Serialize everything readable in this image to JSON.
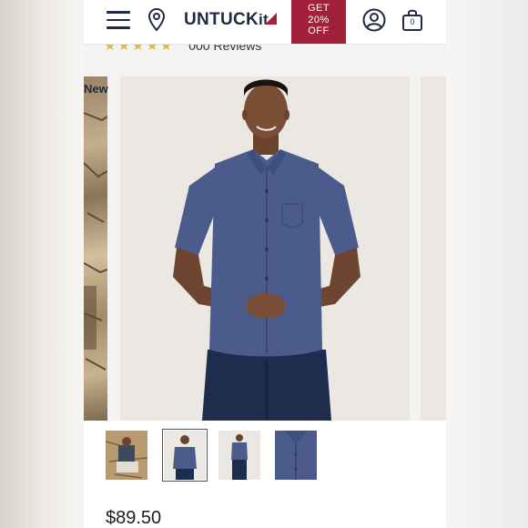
{
  "header": {
    "menu_icon": "hamburger-menu-icon",
    "location_icon": "map-pin-icon",
    "logo_text": "UNTUCK",
    "logo_suffix": "it",
    "promo_line1": "GET",
    "promo_line2": "20%",
    "promo_line3": "OFF",
    "account_icon": "user-account-icon",
    "cart_icon": "shopping-bag-icon",
    "cart_count": "0"
  },
  "reviews": {
    "stars": "★★★★★",
    "count_text": "000 Reviews"
  },
  "gallery": {
    "badge": "New",
    "active_index": 1
  },
  "thumbnails": [
    {
      "label": "lifestyle-seated"
    },
    {
      "label": "front-view"
    },
    {
      "label": "full-front-view"
    },
    {
      "label": "fabric-detail"
    }
  ],
  "product": {
    "price": "$89.50"
  },
  "colors": {
    "brand_navy": "#1f2a44",
    "promo_red": "#a3203a",
    "shirt_blue": "#4a5b8c",
    "star_gold": "#e3b63c"
  }
}
